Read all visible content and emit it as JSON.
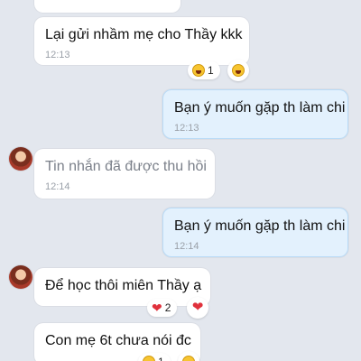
{
  "messages": [
    {
      "id": "m1",
      "text": "Lại gửi nhầm mẹ cho Thầy kkk",
      "time": "12:13",
      "reaction_count": "1"
    },
    {
      "id": "m2",
      "text": "Bạn ý muốn gặp th làm chi",
      "time": "12:13"
    },
    {
      "id": "m3",
      "text": "Tin nhắn đã được thu hồi",
      "time": "12:14"
    },
    {
      "id": "m4",
      "text": "Bạn ý muốn gặp th làm chi",
      "time": "12:14"
    },
    {
      "id": "m5",
      "text": "Để học thôi miên Thầy ạ",
      "reaction_count": "2"
    },
    {
      "id": "m6",
      "text": "Con mẹ 6t chưa nói đc",
      "reaction_count": "1"
    }
  ],
  "colors": {
    "background": "#e3e7ee",
    "incoming_bubble": "#ffffff",
    "outgoing_bubble": "#e3f1fd",
    "heart": "#e0313c"
  },
  "icons": {
    "reaction_laugh": "laugh-emoji-icon",
    "reaction_heart": "heart-icon"
  }
}
